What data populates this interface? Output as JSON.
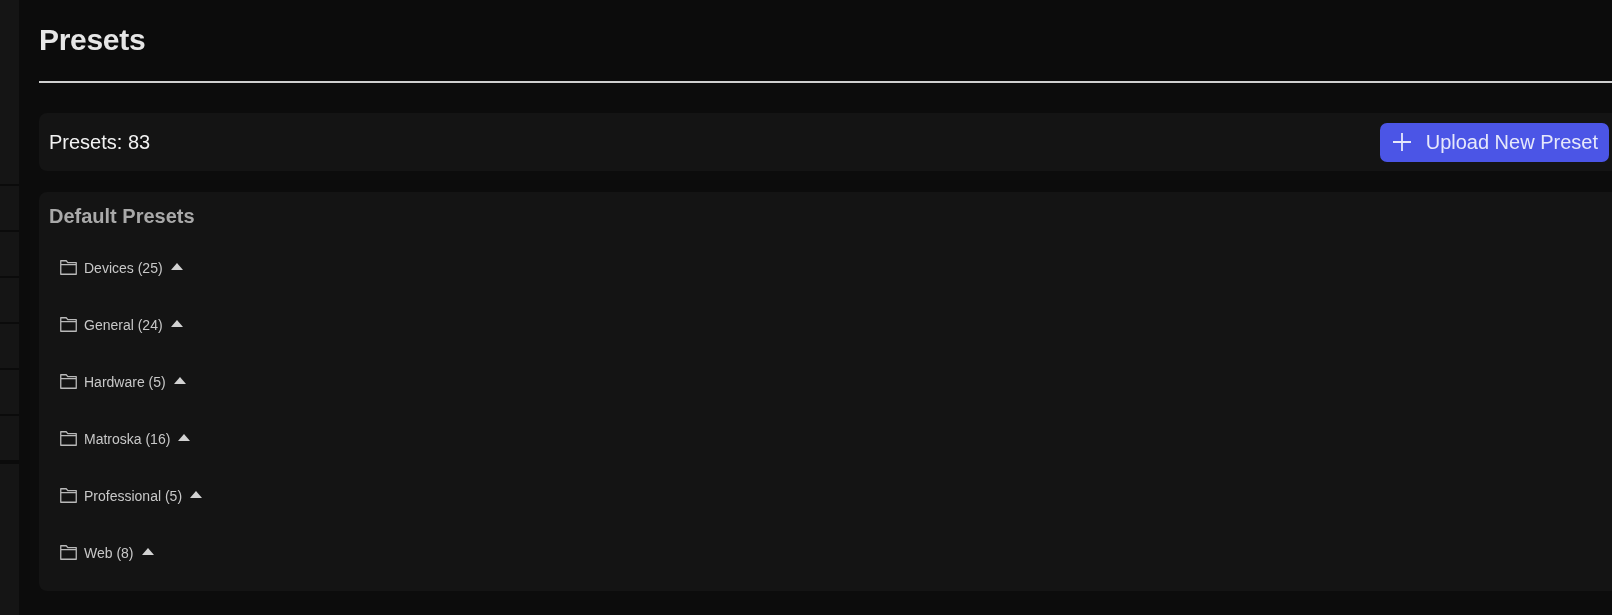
{
  "page": {
    "title": "Presets"
  },
  "summary": {
    "count_label": "Presets: 83",
    "upload_button": {
      "label": "Upload New Preset"
    }
  },
  "default_presets": {
    "heading": "Default Presets",
    "folders": [
      {
        "label": "Devices (25)",
        "expanded": false
      },
      {
        "label": "General (24)",
        "expanded": false
      },
      {
        "label": "Hardware (5)",
        "expanded": false
      },
      {
        "label": "Matroska (16)",
        "expanded": false
      },
      {
        "label": "Professional (5)",
        "expanded": false
      },
      {
        "label": "Web (8)",
        "expanded": false
      }
    ]
  }
}
